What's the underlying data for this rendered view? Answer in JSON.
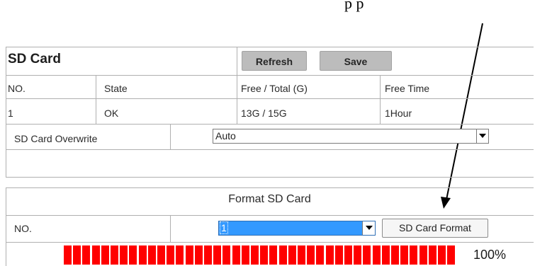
{
  "annotation": {
    "top_text": "p            p"
  },
  "sd_card": {
    "title": "SD Card",
    "refresh_label": "Refresh",
    "save_label": "Save",
    "columns": [
      "NO.",
      "State",
      "Free / Total (G)",
      "Free Time"
    ],
    "rows": [
      {
        "no": "1",
        "state": "OK",
        "free_total": "13G / 15G",
        "free_time": "1Hour"
      }
    ],
    "overwrite": {
      "label": "SD Card Overwrite",
      "value": "Auto"
    }
  },
  "format": {
    "title": "Format SD Card",
    "no_label": "NO.",
    "no_value": "1",
    "format_button_label": "SD Card Format",
    "progress_percent": 100,
    "progress_label": "100%"
  },
  "colors": {
    "progress": "#ff0000",
    "button_gray": "#bcbcbc",
    "select_highlight": "#3399ff"
  }
}
